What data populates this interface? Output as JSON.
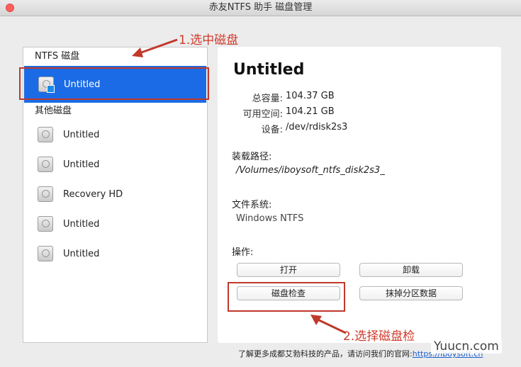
{
  "window": {
    "title": "赤友NTFS 助手 磁盘管理"
  },
  "sidebar": {
    "ntfs_header": "NTFS 磁盘",
    "ntfs_disks": [
      {
        "name": "Untitled",
        "icon": "ntfs-disk-icon"
      }
    ],
    "other_header": "其他磁盘",
    "other_disks": [
      {
        "name": "Untitled",
        "icon": "hard-disk-icon"
      },
      {
        "name": "Untitled",
        "icon": "hard-disk-icon"
      },
      {
        "name": "Recovery HD",
        "icon": "hard-disk-icon"
      },
      {
        "name": "Untitled",
        "icon": "hard-disk-icon"
      },
      {
        "name": "Untitled",
        "icon": "hard-disk-icon"
      }
    ]
  },
  "details": {
    "title": "Untitled",
    "total_label": "总容量:",
    "total_value": "104.37 GB",
    "free_label": "可用空间:",
    "free_value": "104.21 GB",
    "device_label": "设备:",
    "device_value": "/dev/rdisk2s3",
    "mount_label": "装载路径:",
    "mount_value": "/Volumes/iboysoft_ntfs_disk2s3_",
    "fs_label": "文件系统:",
    "fs_value": "Windows NTFS",
    "ops_label": "操作:",
    "buttons": {
      "open": "打开",
      "unmount": "卸载",
      "check": "磁盘检查",
      "erase": "抹掉分区数据"
    }
  },
  "annotations": {
    "step1": "1.选中磁盘",
    "step2": "2.选择磁盘检",
    "color": "#c0392b"
  },
  "footer": {
    "text": "了解更多成都艾勃科技的产品，请访问我们的官网:",
    "link": "https://iboysoft.cn"
  },
  "watermark": "Yuucn.com",
  "colors": {
    "selection": "#1b6be6",
    "close": "#fc605c"
  }
}
